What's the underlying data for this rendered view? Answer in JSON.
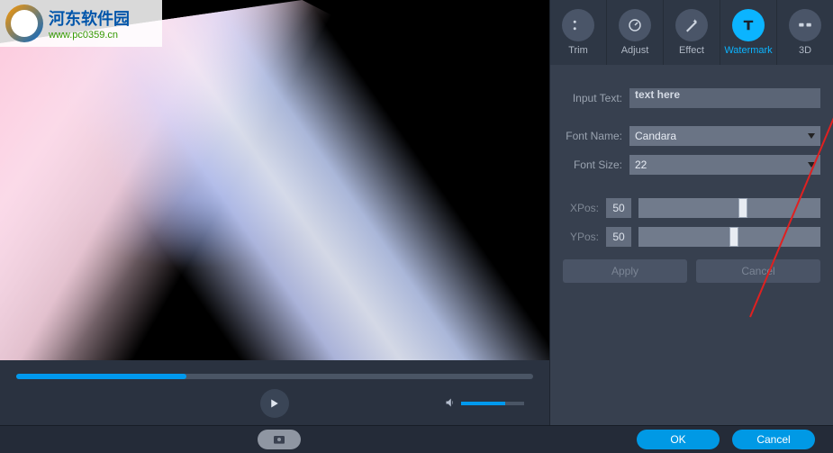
{
  "logo": {
    "cn": "河东软件园",
    "url": "www.pc0359.cn"
  },
  "tabs": [
    {
      "label": "Trim"
    },
    {
      "label": "Adjust"
    },
    {
      "label": "Effect"
    },
    {
      "label": "Watermark"
    },
    {
      "label": "3D"
    }
  ],
  "panel": {
    "input_text_label": "Input Text:",
    "input_text_placeholder": "text here",
    "font_name_label": "Font Name:",
    "font_name_value": "Candara",
    "font_size_label": "Font Size:",
    "font_size_value": "22",
    "xpos_label": "XPos:",
    "xpos_value": "50",
    "ypos_label": "YPos:",
    "ypos_value": "50",
    "apply_label": "Apply",
    "cancel_label": "Cancel"
  },
  "footer": {
    "ok_label": "OK",
    "cancel_label": "Cancel"
  }
}
